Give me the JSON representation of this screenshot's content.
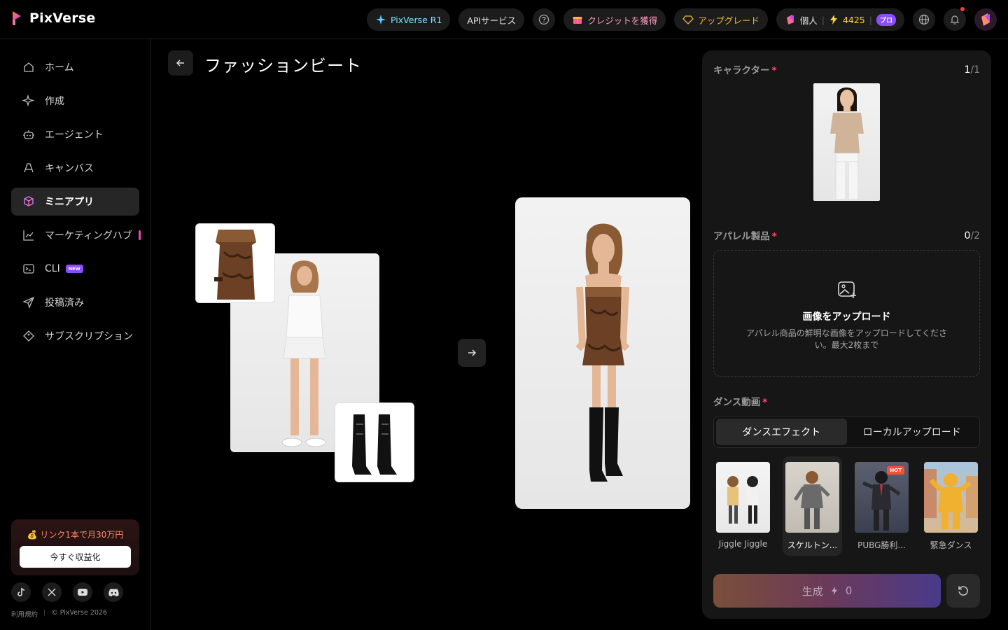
{
  "app": {
    "name": "PixVerse"
  },
  "topbar": {
    "r1_label": "PixVerse R1",
    "api_label": "APIサービス",
    "credits_label": "クレジットを獲得",
    "upgrade_label": "アップグレード",
    "workspace_label": "個人",
    "credit_count": "4425",
    "plan_badge": "プロ"
  },
  "sidebar": {
    "items": [
      {
        "label": "ホーム",
        "icon": "home-icon"
      },
      {
        "label": "作成",
        "icon": "sparkle-icon"
      },
      {
        "label": "エージェント",
        "icon": "robot-icon"
      },
      {
        "label": "キャンバス",
        "icon": "canvas-icon"
      },
      {
        "label": "ミニアプリ",
        "icon": "cube-icon"
      },
      {
        "label": "マーケティングハブ",
        "icon": "chart-icon"
      },
      {
        "label": "CLI",
        "icon": "terminal-icon",
        "badge": "NEW"
      },
      {
        "label": "投稿済み",
        "icon": "send-icon"
      },
      {
        "label": "サブスクリプション",
        "icon": "diamond-icon"
      }
    ],
    "promo_text": "💰 リンク1本で月30万円",
    "promo_button": "今すぐ収益化",
    "terms": "利用規約",
    "copyright": "© PixVerse 2026"
  },
  "main": {
    "title": "ファッションビート"
  },
  "panel": {
    "character": {
      "label": "キャラクター",
      "count": "1",
      "total": "/1"
    },
    "apparel": {
      "label": "アパレル製品",
      "count": "0",
      "total": "/2",
      "upload_title": "画像をアップロード",
      "upload_desc": "アパレル商品の鮮明な画像をアップロードしてください。最大2枚まで"
    },
    "dance": {
      "label": "ダンス動画",
      "tabs": [
        "ダンスエフェクト",
        "ローカルアップロード"
      ],
      "items": [
        {
          "label": "Jiggle Jiggle"
        },
        {
          "label": "スケルトン..."
        },
        {
          "label": "PUBG勝利...",
          "badge": "HOT"
        },
        {
          "label": "緊急ダンス"
        }
      ]
    },
    "generate_label": "生成",
    "generate_cost": "0"
  },
  "colors": {
    "accent_purple": "#8b4dff",
    "required_red": "#ff4d6a",
    "promo_orange": "#ff8a6b"
  }
}
